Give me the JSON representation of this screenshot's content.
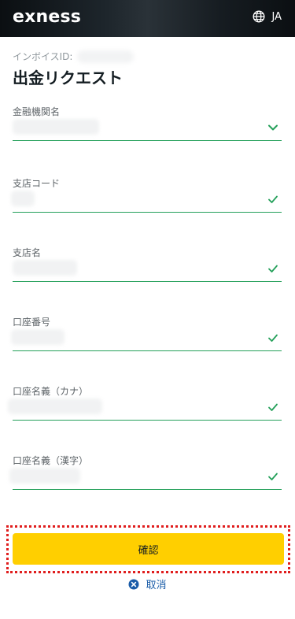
{
  "header": {
    "logo": "exness",
    "language": "JA",
    "globe_icon": "globe-icon"
  },
  "form": {
    "invoice_label": "インボイスID:",
    "title": "出金リクエスト",
    "fields": [
      {
        "label": "金融機関名",
        "indicator": "chevron-down-icon"
      },
      {
        "label": "支店コード",
        "indicator": "check-icon"
      },
      {
        "label": "支店名",
        "indicator": "check-icon"
      },
      {
        "label": "口座番号",
        "indicator": "check-icon"
      },
      {
        "label": "口座名義（カナ）",
        "indicator": "check-icon"
      },
      {
        "label": "口座名義（漢字）",
        "indicator": "check-icon"
      }
    ]
  },
  "actions": {
    "confirm_label": "確認",
    "cancel_label": "取消",
    "cancel_icon": "close-circle-icon"
  },
  "colors": {
    "header_bg": "#141d22",
    "accent_yellow": "#ffcf00",
    "valid_green": "#24a05a",
    "highlight_red": "#e01d1d",
    "link_blue": "#1a5ca8"
  }
}
